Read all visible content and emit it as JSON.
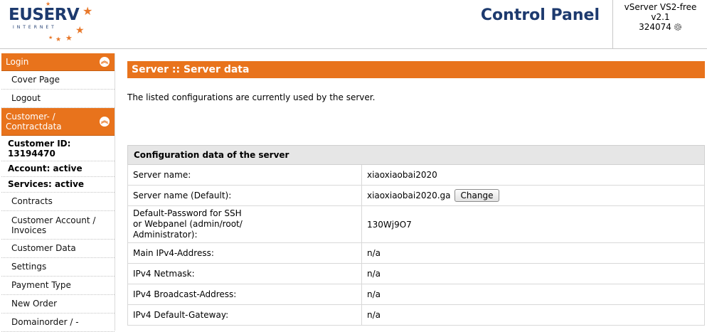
{
  "brand": {
    "logo_text": "EUSERV",
    "logo_sub": "INTERNET"
  },
  "header": {
    "title": "Control Panel"
  },
  "server_box": {
    "line1": "vServer VS2-free",
    "line2": "v2.1",
    "line3": "324074"
  },
  "sidebar": {
    "login_header": "Login",
    "login_items": [
      "Cover Page",
      "Logout"
    ],
    "customer_header_line1": "Customer- /",
    "customer_header_line2": "Contractdata",
    "customer_id_label": "Customer ID:",
    "customer_id_value": "13194470",
    "account_status": "Account: active",
    "services_status": "Services: active",
    "items": [
      "Contracts",
      "Customer Account /",
      "Invoices",
      "Customer Data",
      "Settings",
      "Payment Type",
      "New Order",
      "Domainorder / -"
    ]
  },
  "main": {
    "title": "Server :: Server data",
    "intro": "The listed configurations are currently used by the server.",
    "table_title": "Configuration data of the server",
    "change_label": "Change",
    "rows": [
      {
        "key": "Server name:",
        "value": "xiaoxiaobai2020"
      },
      {
        "key": "Server name (Default):",
        "value": "xiaoxiaobai2020.ga"
      },
      {
        "key_l1": "Default-Password for SSH",
        "key_l2": "or Webpanel (admin/root/",
        "key_l3": "Administrator):",
        "value": "130Wj9O7"
      },
      {
        "key": "Main IPv4-Address:",
        "value": "n/a"
      },
      {
        "key": "IPv4 Netmask:",
        "value": "n/a"
      },
      {
        "key": "IPv4 Broadcast-Address:",
        "value": "n/a"
      },
      {
        "key": "IPv4 Default-Gateway:",
        "value": "n/a"
      }
    ]
  },
  "colors": {
    "accent": "#e8731c",
    "brand_blue": "#1d3a6e"
  }
}
